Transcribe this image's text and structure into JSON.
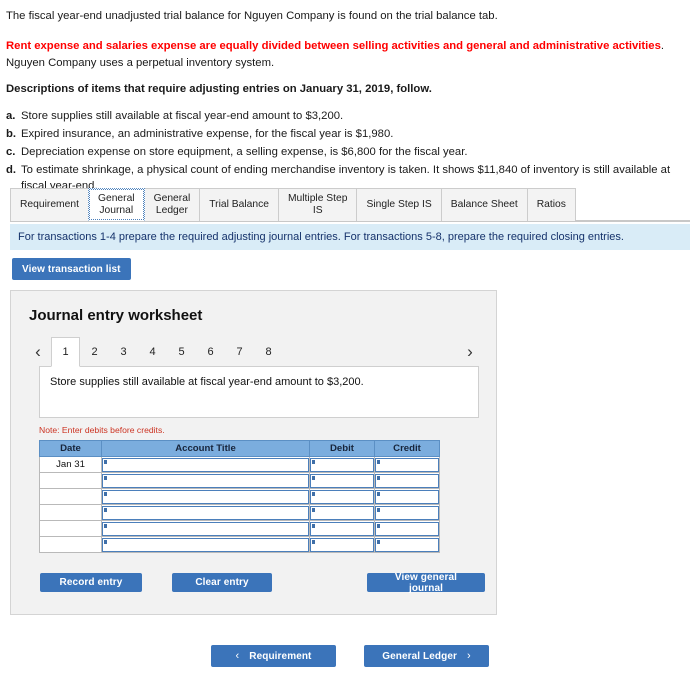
{
  "intro": {
    "lead": "The fiscal year-end unadjusted trial balance for Nguyen Company is found on the trial balance tab.",
    "highlight_red": "Rent expense and salaries expense are equally divided between selling activities and  general and administrative activities",
    "highlight_tail": ". Nguyen Company uses a perpetual inventory system.",
    "descriptions_heading": "Descriptions of items that require adjusting entries on January 31, 2019, follow.",
    "items": [
      {
        "marker": "a.",
        "text": "Store supplies still available at fiscal year-end amount to $3,200."
      },
      {
        "marker": "b.",
        "text": "Expired insurance, an administrative expense, for the fiscal year is $1,980."
      },
      {
        "marker": "c.",
        "text": "Depreciation expense on store equipment, a selling expense, is $6,800 for the fiscal year."
      },
      {
        "marker": "d.",
        "text": "To estimate shrinkage, a physical count of ending merchandise inventory is taken. It shows $11,840 of inventory is still available at fiscal year-end."
      }
    ]
  },
  "tabs": [
    {
      "label": "Requirement",
      "active": false
    },
    {
      "label": "General\nJournal",
      "active": true
    },
    {
      "label": "General\nLedger",
      "active": false
    },
    {
      "label": "Trial Balance",
      "active": false
    },
    {
      "label": "Multiple Step\nIS",
      "active": false
    },
    {
      "label": "Single Step IS",
      "active": false
    },
    {
      "label": "Balance Sheet",
      "active": false
    },
    {
      "label": "Ratios",
      "active": false
    }
  ],
  "instruction_bar": "For transactions 1-4 prepare the required adjusting journal entries. For transactions 5-8, prepare the required closing entries.",
  "view_transaction_list_label": "View transaction list",
  "worksheet": {
    "title": "Journal entry worksheet",
    "prev_arrow": "‹",
    "next_arrow": "›",
    "pages": [
      "1",
      "2",
      "3",
      "4",
      "5",
      "6",
      "7",
      "8"
    ],
    "active_page": "1",
    "description": "Store supplies still available at fiscal year-end amount to $3,200.",
    "note": "Note: Enter debits before credits.",
    "table": {
      "headers": [
        "Date",
        "Account Title",
        "Debit",
        "Credit"
      ],
      "rows": [
        {
          "date": "Jan 31",
          "account": "",
          "debit": "",
          "credit": ""
        },
        {
          "date": "",
          "account": "",
          "debit": "",
          "credit": ""
        },
        {
          "date": "",
          "account": "",
          "debit": "",
          "credit": ""
        },
        {
          "date": "",
          "account": "",
          "debit": "",
          "credit": ""
        },
        {
          "date": "",
          "account": "",
          "debit": "",
          "credit": ""
        },
        {
          "date": "",
          "account": "",
          "debit": "",
          "credit": ""
        }
      ]
    },
    "actions": {
      "record": "Record entry",
      "clear": "Clear entry",
      "view_general_journal": "View general journal"
    }
  },
  "footer_nav": {
    "prev_label": "Requirement",
    "prev_chevron": "‹",
    "next_label": "General Ledger",
    "next_chevron": "›"
  },
  "colors": {
    "accent_blue": "#3b74ba",
    "instruction_bg": "#d9ecf7",
    "table_header_blue": "#7badde",
    "alert_red": "#ff0000",
    "note_red": "#cc3322"
  }
}
